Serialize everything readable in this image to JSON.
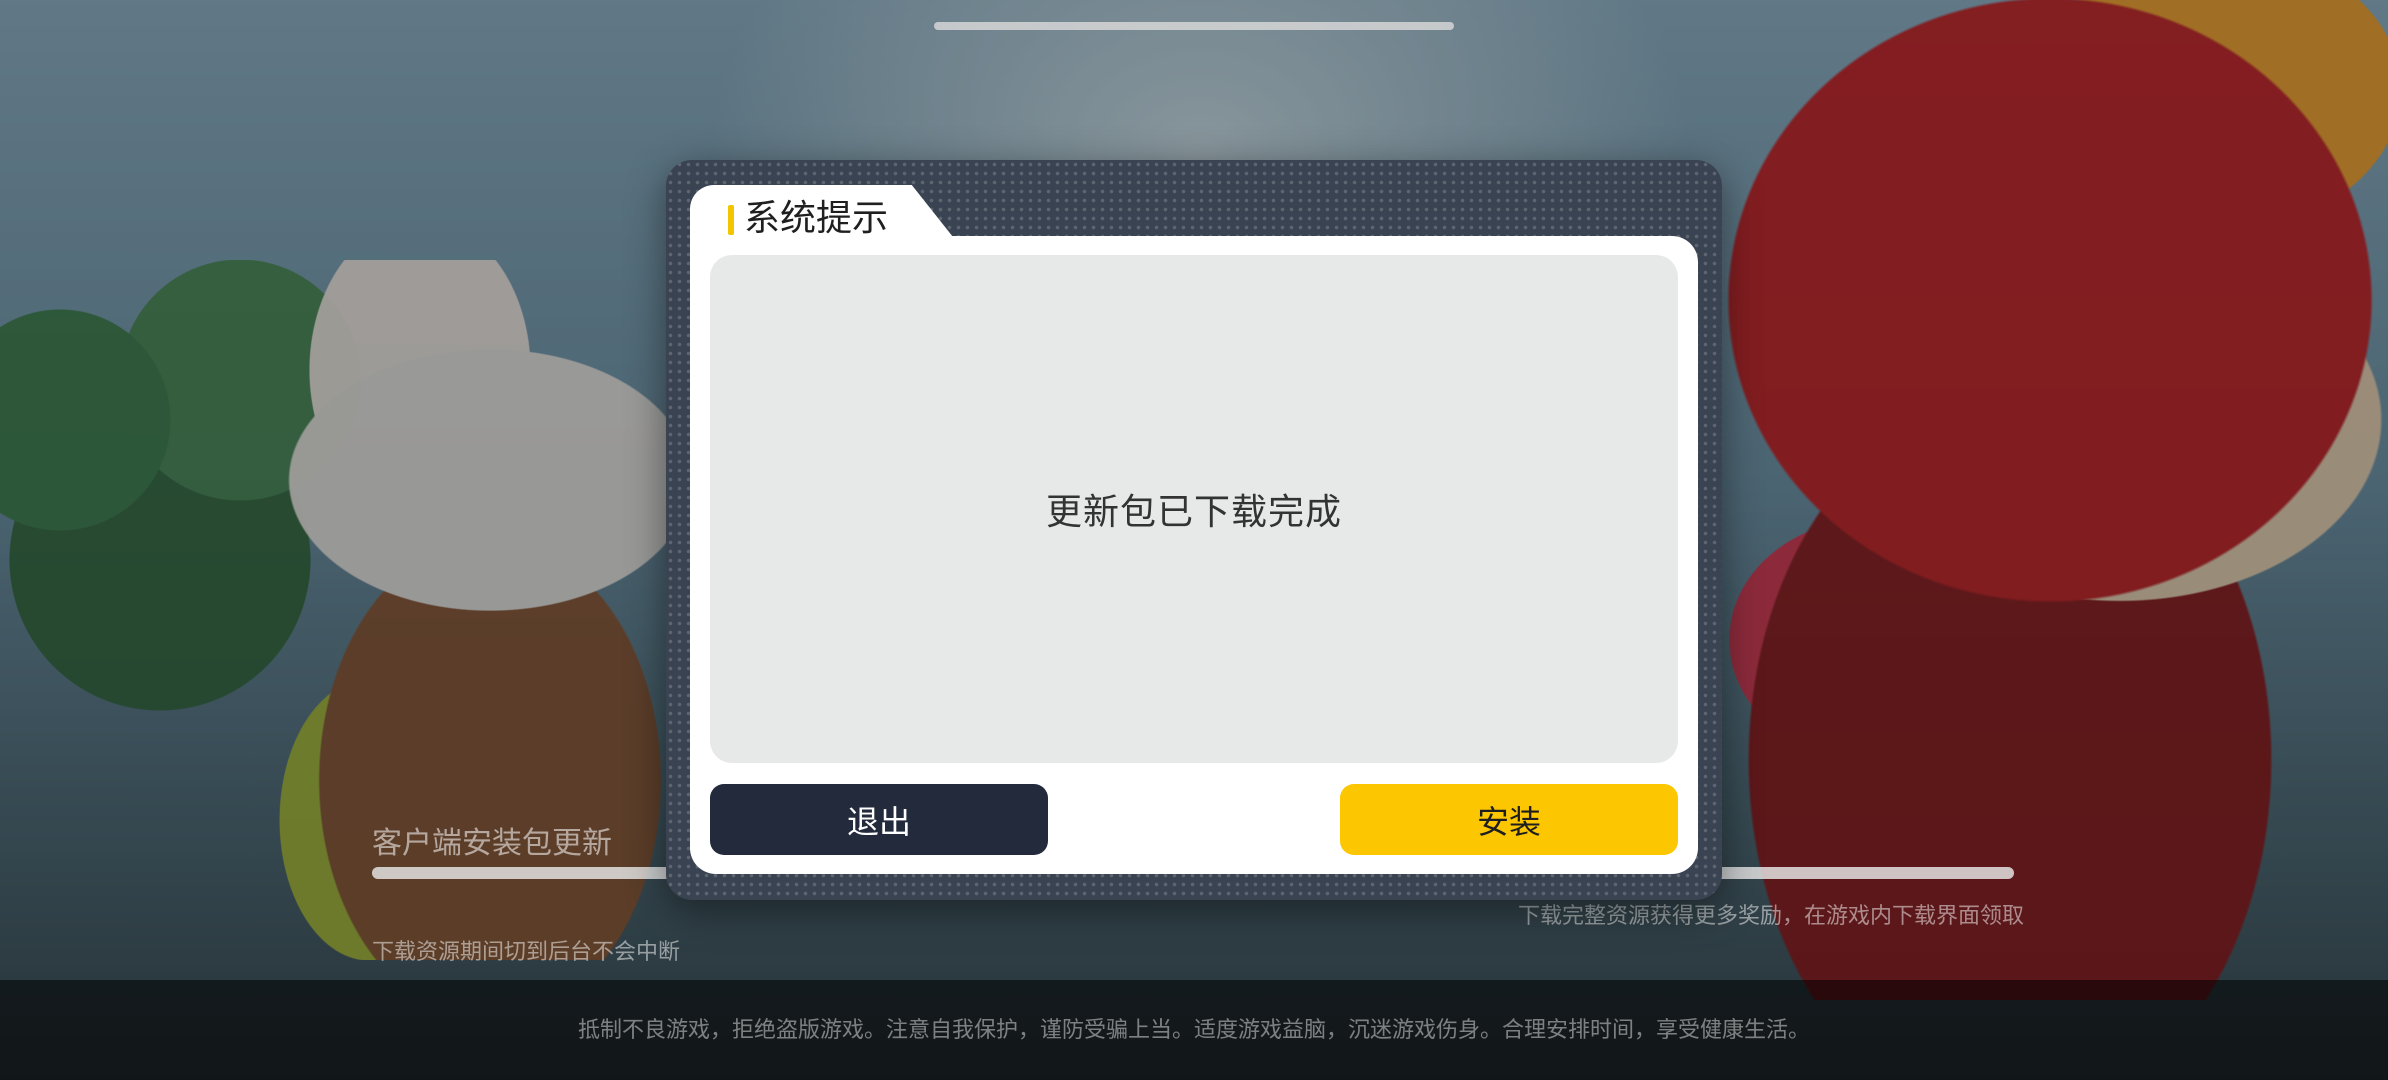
{
  "dialog": {
    "title": "系统提示",
    "message": "更新包已下载完成",
    "exit_label": "退出",
    "install_label": "安装"
  },
  "background": {
    "update_label": "客户端安装包更新",
    "progress": 1.0,
    "hint_left": "下载资源期间切到后台不会中断",
    "hint_right": "下载完整资源获得更多奖励，在游戏内下载界面领取",
    "footer_notice": "抵制不良游戏，拒绝盗版游戏。注意自我保护，谨防受骗上当。适度游戏益脑，沉迷游戏伤身。合理安排时间，享受健康生活。"
  },
  "colors": {
    "accent_yellow": "#fcc600",
    "exit_button": "#232a3b",
    "frame": "#3a4351",
    "message_bg": "#e7e9e8"
  }
}
